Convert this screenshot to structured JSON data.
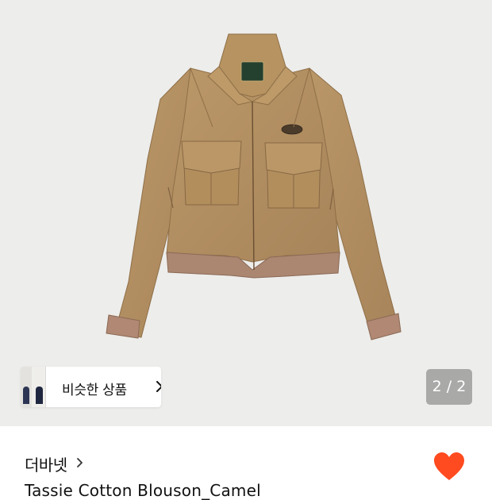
{
  "gallery": {
    "similar_label": "비슷한 상품",
    "page_counter": "2 / 2",
    "current_page": 2,
    "total_pages": 2
  },
  "product": {
    "brand": "더바넷",
    "title": "Tassie Cotton Blouson_Camel",
    "liked": true
  },
  "colors": {
    "heart": "#ff4b1f",
    "jacket": "#b08c5f",
    "gallery_bg": "#ededeb"
  },
  "icons": {
    "brand_chevron": "chevron-right-icon",
    "chip_chevron": "chevron-right-icon",
    "like": "heart-icon"
  }
}
